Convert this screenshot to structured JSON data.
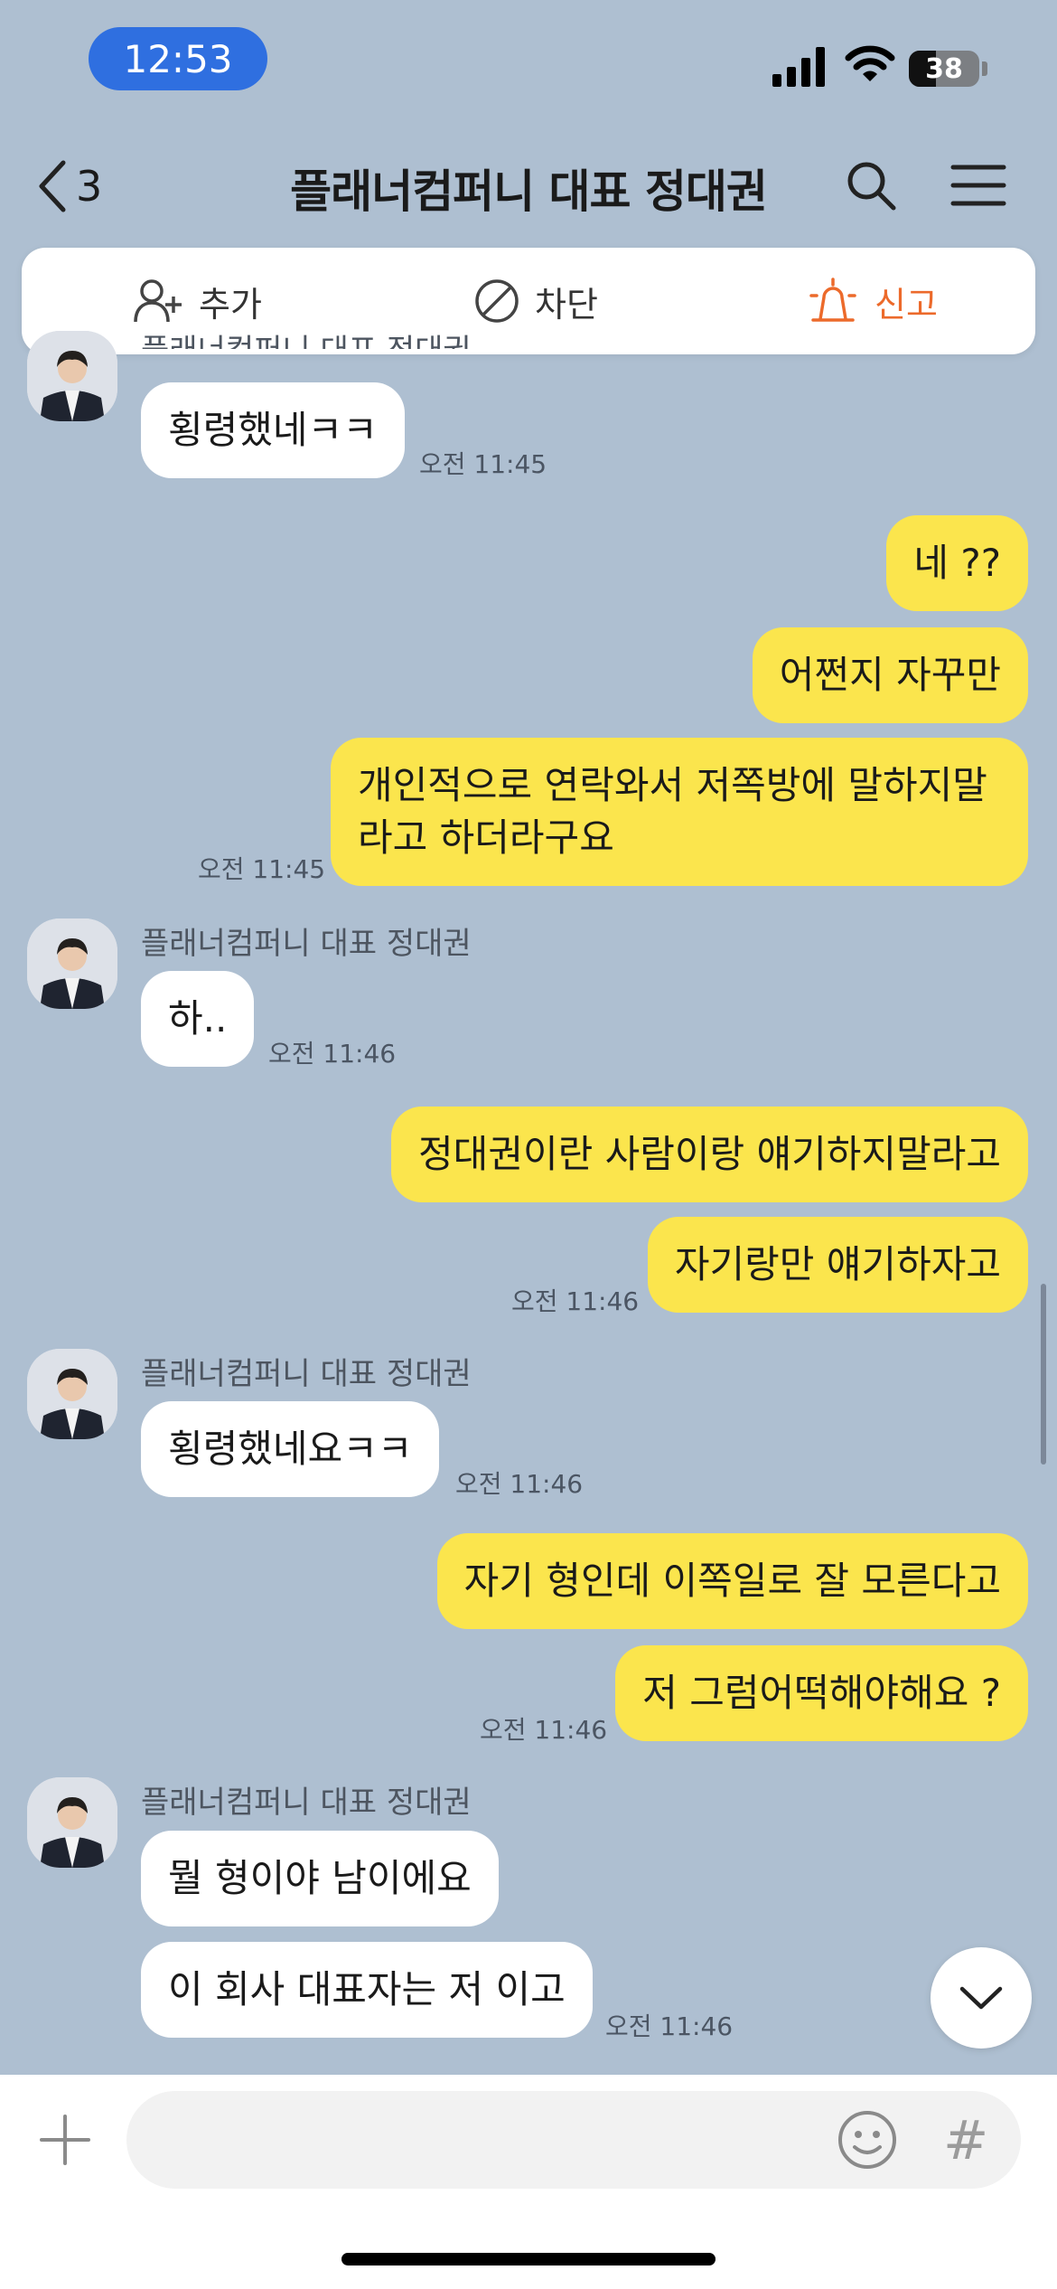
{
  "status_bar": {
    "time": "12:53",
    "battery": "38"
  },
  "header": {
    "back_count": "3",
    "title": "플래너컴퍼니 대표 정대권"
  },
  "actions": {
    "add": "추가",
    "block": "차단",
    "report": "신고"
  },
  "messages": {
    "m0": {
      "sender": "플래너컴퍼니 대표 정대권",
      "text": "횡령했네ㅋㅋ",
      "time": "오전 11:45"
    },
    "m1": {
      "text": "네 ??"
    },
    "m2": {
      "text": "어쩐지 자꾸만"
    },
    "m3": {
      "text": "개인적으로 연락와서  저쪽방에 말하지말라고 하더라구요",
      "time": "오전 11:45"
    },
    "m4": {
      "sender": "플래너컴퍼니 대표 정대권",
      "text": "하..",
      "time": "오전 11:46"
    },
    "m5": {
      "text": "정대권이란 사람이랑 얘기하지말라고"
    },
    "m6": {
      "text": "자기랑만 얘기하자고",
      "time": "오전 11:46"
    },
    "m7": {
      "sender": "플래너컴퍼니 대표 정대권",
      "text": "횡령했네요ㅋㅋ",
      "time": "오전 11:46"
    },
    "m8": {
      "text": "자기 형인데  이쪽일로 잘 모른다고"
    },
    "m9": {
      "text": "저 그럼어떡해야해요 ?",
      "time": "오전 11:46"
    },
    "m10": {
      "sender": "플래너컴퍼니 대표 정대권",
      "text": "뭘 형이야 남이에요"
    },
    "m11": {
      "text": "이 회사 대표자는 저 이고",
      "time": "오전 11:46"
    }
  },
  "composer": {
    "placeholder": ""
  },
  "colors": {
    "background": "#aebfd1",
    "outgoing": "#fbe54d",
    "incoming": "#ffffff",
    "report": "#ec6a2b"
  },
  "icons": [
    "signal-icon",
    "wifi-icon",
    "battery-icon",
    "back-chevron-icon",
    "search-icon",
    "menu-icon",
    "add-friend-icon",
    "block-icon",
    "report-siren-icon",
    "chevron-down-icon",
    "plus-icon",
    "emoji-icon",
    "hash-icon"
  ]
}
